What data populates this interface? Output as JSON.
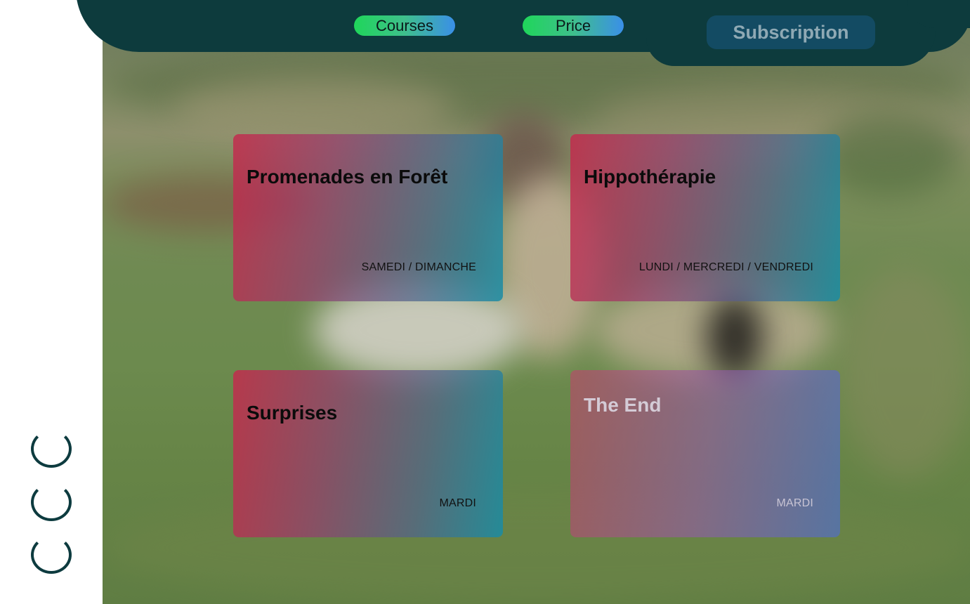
{
  "nav": {
    "courses_label": "Courses",
    "price_label": "Price",
    "subscription_label": "Subscription"
  },
  "cards": [
    {
      "title": "Promenades en Forêt",
      "days": "SAMEDI / DIMANCHE"
    },
    {
      "title": "Hippothérapie",
      "days": "LUNDI / MERCREDI / VENDREDI"
    },
    {
      "title": "Surprises",
      "days": "MARDI"
    },
    {
      "title": "The End",
      "days": "MARDI"
    }
  ],
  "sidebar": {
    "indicators": [
      "loading-indicator",
      "loading-indicator",
      "loading-indicator"
    ]
  },
  "colors": {
    "banner": "#0d3b3d",
    "pill_gradient_start": "#1fd65a",
    "pill_gradient_end": "#3a8fe8",
    "subscription_bg": "#134b63",
    "card_gradient_start": "#c6284c",
    "card_gradient_end": "#198ca5"
  }
}
